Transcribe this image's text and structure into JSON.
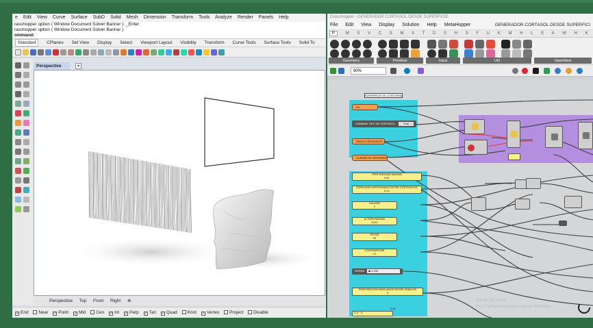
{
  "rhino": {
    "menu": [
      "e",
      "Edit",
      "View",
      "Curve",
      "Surface",
      "SubD",
      "Solid",
      "Mesh",
      "Dimension",
      "Transform",
      "Tools",
      "Analyze",
      "Render",
      "Panels",
      "Help"
    ],
    "history": [
      "rasshopper option ( Window  Document  Solver  Banner ): _Enter",
      "rasshopper option ( Window  Document  Solver  Banner )"
    ],
    "prompt": "ommand:",
    "toolbar_tabs": [
      "Standard",
      "CPlanes",
      "Set View",
      "Display",
      "Select",
      "Viewport Layout",
      "Visibility",
      "Transform",
      "Curve Tools",
      "Surface Tools",
      "Solid To"
    ],
    "viewport_label": "Perspective",
    "viewport_arrow": "▾",
    "view_tabs": [
      "Perspective",
      "Top",
      "Front",
      "Right",
      "⊕"
    ],
    "osnaps": [
      {
        "label": "End",
        "checked": true
      },
      {
        "label": "Near",
        "checked": false
      },
      {
        "label": "Point",
        "checked": true
      },
      {
        "label": "Mid",
        "checked": true
      },
      {
        "label": "Cen",
        "checked": false
      },
      {
        "label": "Int",
        "checked": true
      },
      {
        "label": "Perp",
        "checked": true
      },
      {
        "label": "Tan",
        "checked": true
      },
      {
        "label": "Quad",
        "checked": true
      },
      {
        "label": "Knot",
        "checked": false
      },
      {
        "label": "Vertex",
        "checked": true
      },
      {
        "label": "Project",
        "checked": false
      },
      {
        "label": "Disable",
        "checked": false
      }
    ]
  },
  "grasshopper": {
    "title": "Grasshopper - GENERADOR CORTASOL DESDE SUPERFICIE",
    "menu": [
      "File",
      "Edit",
      "View",
      "Display",
      "Solution",
      "Help",
      "MetaHopper"
    ],
    "doc_title": "GENERADOR CORTASOL DESDE SUPERFICI",
    "tabs": [
      "P",
      "M",
      "S",
      "V",
      "C",
      "S",
      "M",
      "X",
      "T",
      "D",
      "S",
      "H",
      "S",
      "F",
      "U",
      "K",
      "M",
      "H",
      "L",
      "E",
      "A",
      "W",
      "H",
      "K",
      "L"
    ],
    "groups": [
      "Geometry",
      "Primitive",
      "Input",
      "Util",
      "OpenNest"
    ],
    "zoom": "90%",
    "canvas": {
      "top_label": "SUPERFICIE DE CONTORNO",
      "srf_param": "Srf",
      "toggle_label": "CAMBIAR TIPO DE CORTASOL",
      "toggle_value": "True",
      "area_param": "AREA CORTASOLES",
      "curves_param": "CURVAS DE REFERENCIA",
      "sliders": [
        {
          "title": "PROFUNDIDAD MAXIMA",
          "value": "0.61"
        },
        {
          "title": "ESPACIADO APROXIMADO ENTRE CORTASOLES",
          "value": "0.12"
        },
        {
          "title": "CALIBRE",
          "value": "2"
        },
        {
          "title": "ALTURA MAXIMA",
          "value": "3.641"
        },
        {
          "title": "ROTAR",
          "value": "92"
        },
        {
          "title": "CONTRAROTAR",
          "value": "0.1"
        }
      ],
      "orden_label": "ORDEN",
      "orden_value": "◆ 4.096",
      "perforation_title": "PERFORACION PARA UNION ENTRE PANELES",
      "perforation_value": "3",
      "bottom_value": "0.01",
      "bottom_param": "0.1* · 0",
      "watermark_1": "Activar Windows",
      "watermark_2": "Ve a Configuración para activar Windows."
    }
  }
}
